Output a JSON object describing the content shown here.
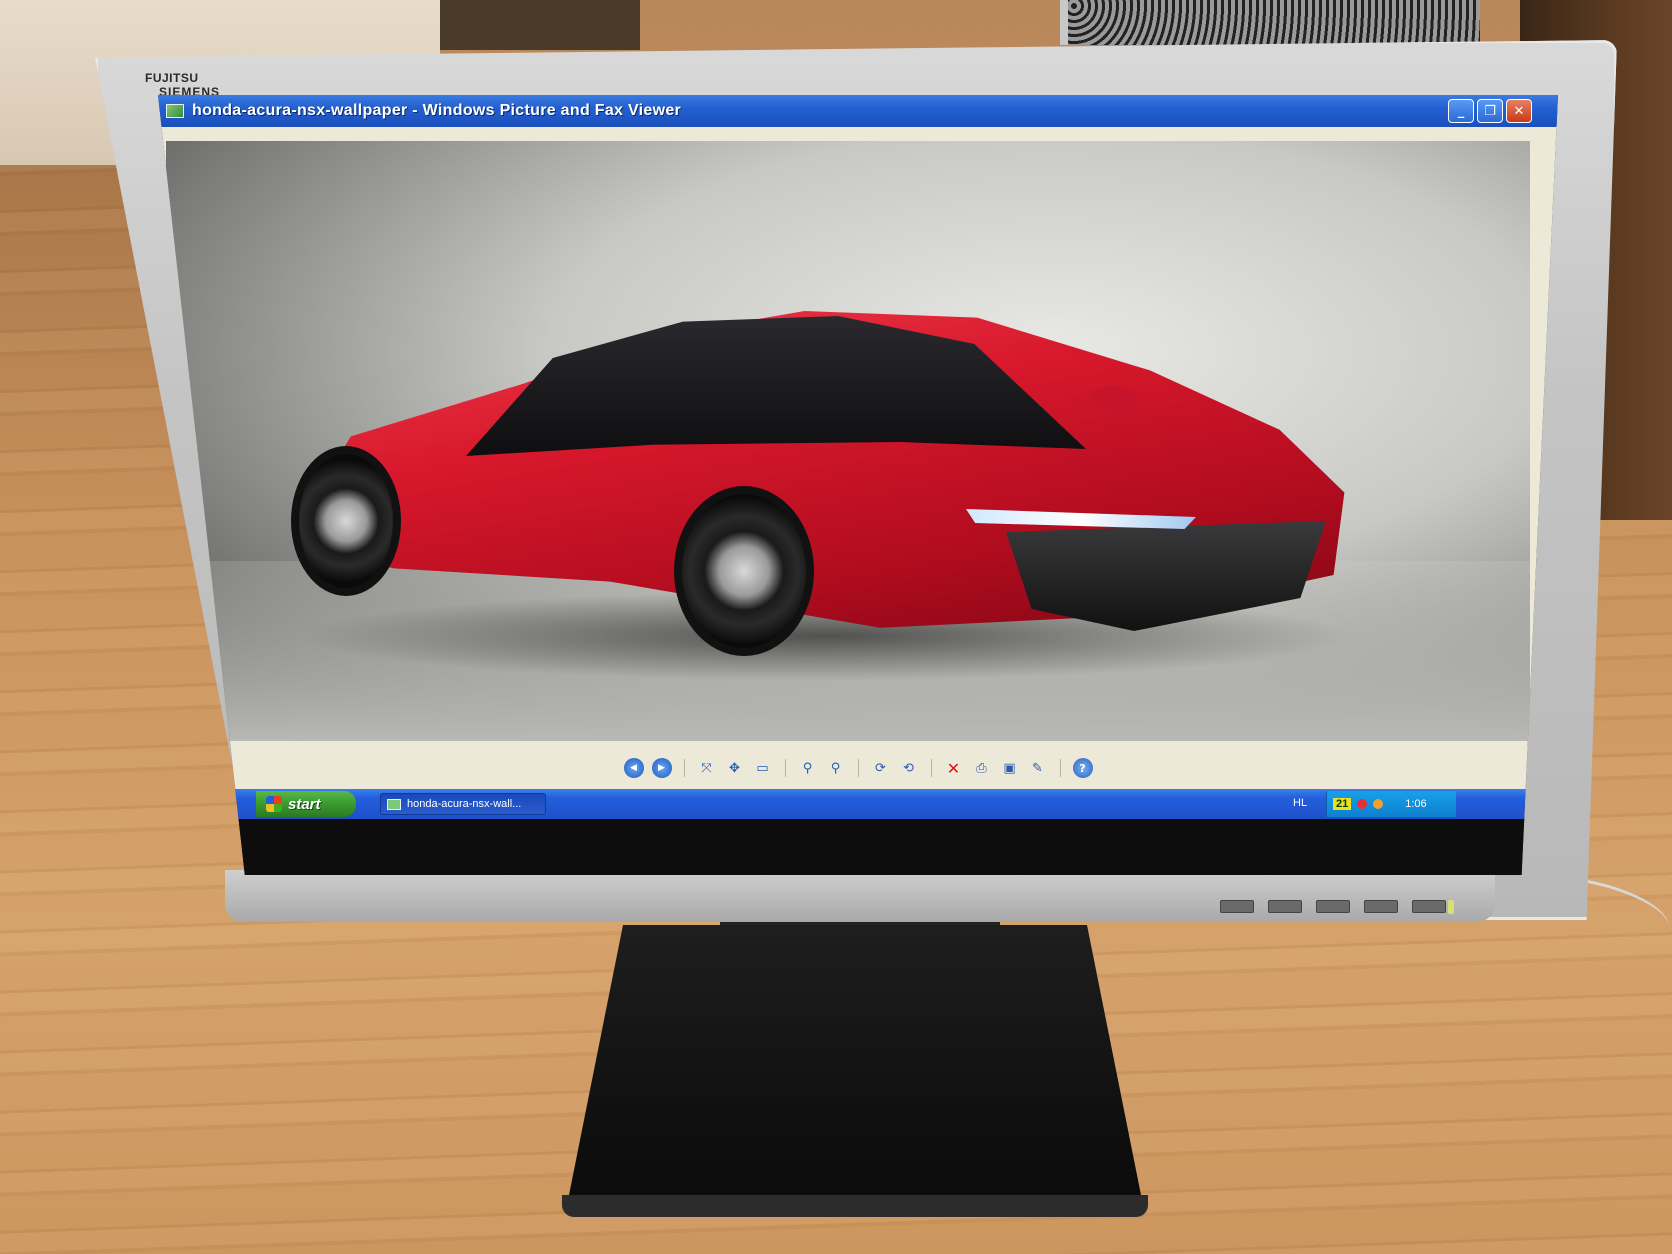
{
  "window": {
    "title": "honda-acura-nsx-wallpaper - Windows Picture and Fax Viewer",
    "app_icon": "picture-viewer-icon",
    "minimize_icon": "minimize-icon",
    "maximize_icon": "restore-icon",
    "close_icon": "close-icon"
  },
  "toolbar": {
    "items": [
      {
        "icon": "previous-image-icon"
      },
      {
        "icon": "next-image-icon"
      },
      {
        "icon": "best-fit-icon"
      },
      {
        "icon": "actual-size-icon"
      },
      {
        "icon": "slideshow-icon"
      },
      {
        "icon": "zoom-in-icon"
      },
      {
        "icon": "zoom-out-icon"
      },
      {
        "icon": "rotate-clockwise-icon"
      },
      {
        "icon": "rotate-counterclockwise-icon"
      },
      {
        "icon": "delete-icon"
      },
      {
        "icon": "print-icon"
      },
      {
        "icon": "save-icon"
      },
      {
        "icon": "edit-icon"
      },
      {
        "icon": "help-icon"
      }
    ]
  },
  "taskbar": {
    "start_label": "start",
    "task_label": "honda-acura-nsx-wall...",
    "language": "HL",
    "tray_badge": "21",
    "clock": "1:06"
  },
  "monitor": {
    "brand_line1": "FUJITSU",
    "brand_line2": "SIEMENS",
    "bezel_color": "#c4c4c4",
    "stand_color": "#111111"
  },
  "colors": {
    "titlebar": "#2460d0",
    "start_button": "#3a9a30",
    "car_red": "#d8182c"
  }
}
